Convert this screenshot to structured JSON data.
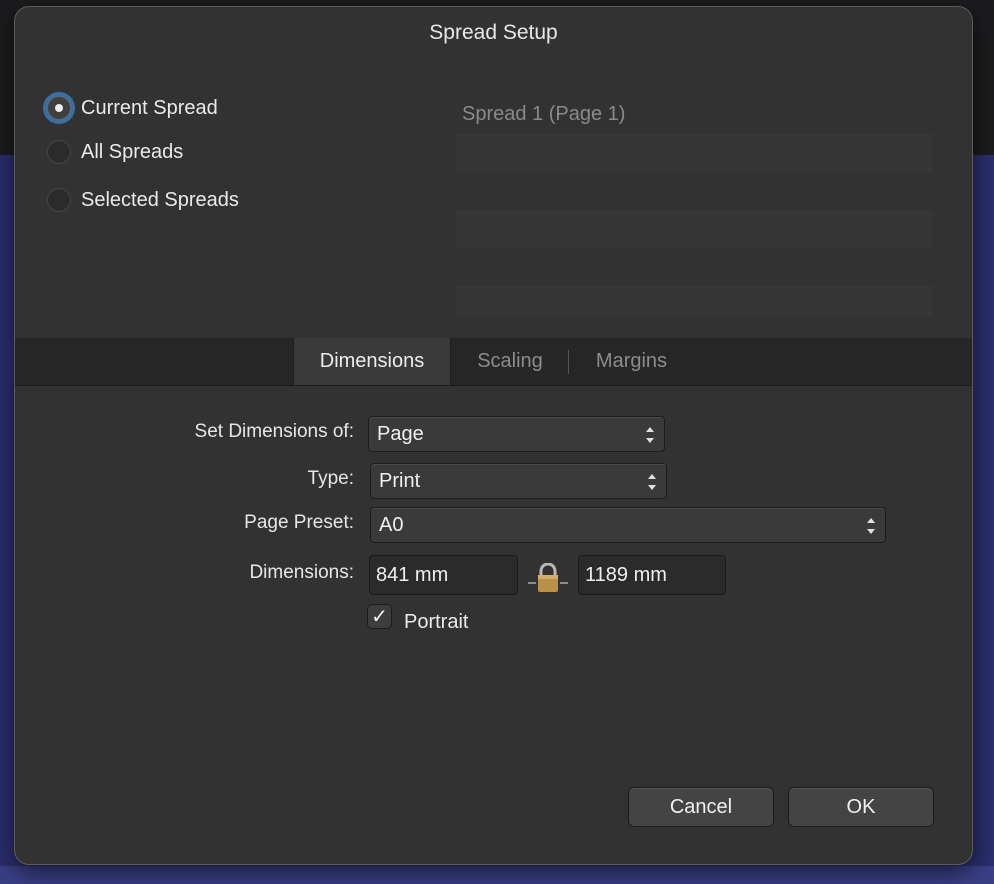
{
  "dialog": {
    "title": "Spread Setup"
  },
  "scope": {
    "options": [
      {
        "label": "Current Spread",
        "selected": true
      },
      {
        "label": "All Spreads",
        "selected": false
      },
      {
        "label": "Selected Spreads",
        "selected": false
      }
    ]
  },
  "spread_list": {
    "header": "Spread 1 (Page 1)"
  },
  "tabs": [
    {
      "label": "Dimensions",
      "active": true
    },
    {
      "label": "Scaling",
      "active": false
    },
    {
      "label": "Margins",
      "active": false
    }
  ],
  "form": {
    "set_dimensions_label": "Set Dimensions of:",
    "set_dimensions_value": "Page",
    "type_label": "Type:",
    "type_value": "Print",
    "preset_label": "Page Preset:",
    "preset_value": "A0",
    "dimensions_label": "Dimensions:",
    "width_value": "841 mm",
    "height_value": "1189 mm",
    "lock_icon": "lock-icon",
    "portrait_checked": true,
    "portrait_label": "Portrait"
  },
  "buttons": {
    "cancel": "Cancel",
    "ok": "OK"
  },
  "colors": {
    "accent_radio_ring": "#3b6fa3",
    "dialog_bg": "#323232",
    "desktop_bg": "#2a2e6b"
  }
}
